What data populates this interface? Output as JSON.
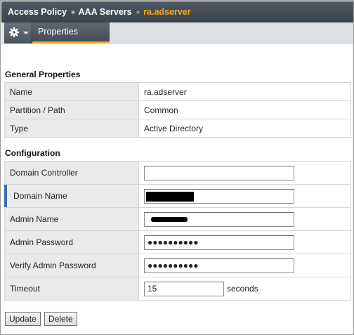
{
  "breadcrumb": {
    "items": [
      "Access Policy",
      "AAA Servers"
    ],
    "current": "ra.adserver",
    "separator": "»"
  },
  "toolbar": {
    "gear_icon": "gear-icon",
    "tab_label": "Properties"
  },
  "general": {
    "title": "General Properties",
    "rows": [
      {
        "label": "Name",
        "value": "ra.adserver"
      },
      {
        "label": "Partition / Path",
        "value": "Common"
      },
      {
        "label": "Type",
        "value": "Active Directory"
      }
    ]
  },
  "configuration": {
    "title": "Configuration",
    "domain_controller": {
      "label": "Domain Controller",
      "value": ""
    },
    "domain_name": {
      "label": "Domain Name",
      "value": ""
    },
    "admin_name": {
      "label": "Admin Name",
      "value": ""
    },
    "admin_password": {
      "label": "Admin Password",
      "value": "●●●●●●●●●●"
    },
    "verify_password": {
      "label": "Verify Admin Password",
      "value": "●●●●●●●●●●"
    },
    "timeout": {
      "label": "Timeout",
      "value": "15",
      "unit": "seconds"
    }
  },
  "actions": {
    "update": "Update",
    "delete": "Delete"
  },
  "colors": {
    "accent": "#f6a81c",
    "header_bg": "#434b53",
    "marker": "#3e6fa8"
  }
}
